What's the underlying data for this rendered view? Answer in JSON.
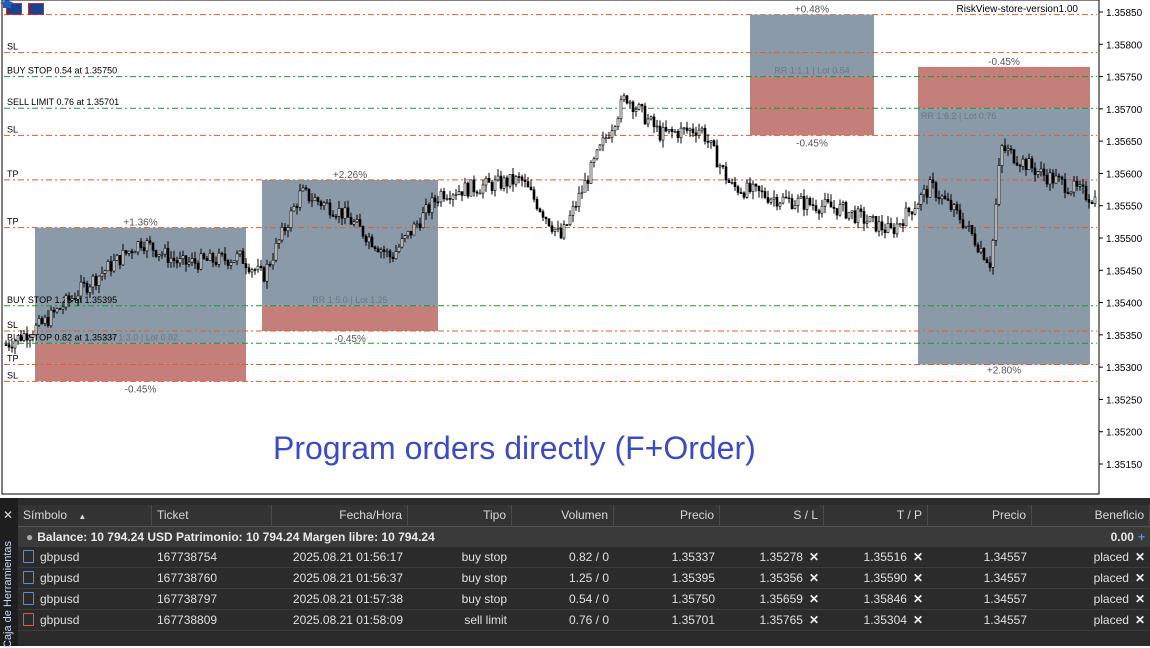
{
  "chart": {
    "indicator_title": "RiskView-store-version1.00",
    "headline": "Program orders directly (F+Order)",
    "price_scale": {
      "ticks": [
        "1.35850",
        "1.35800",
        "1.35750",
        "1.35700",
        "1.35650",
        "1.35600",
        "1.35550",
        "1.35500",
        "1.35450",
        "1.35400",
        "1.35350",
        "1.35300",
        "1.35250",
        "1.35200",
        "1.35150"
      ],
      "min": 1.3513,
      "max": 1.35865
    },
    "level_labels": [
      {
        "text": "SL",
        "price": 1.35787
      },
      {
        "text": "BUY STOP 0.54 at 1.35750",
        "price": 1.3575
      },
      {
        "text": "SELL LIMIT 0.76 at 1.35701",
        "price": 1.35701
      },
      {
        "text": "SL",
        "price": 1.35659
      },
      {
        "text": "TP",
        "price": 1.3559
      },
      {
        "text": "TP",
        "price": 1.35516
      },
      {
        "text": "BUY STOP 1.25 at 1.35395",
        "price": 1.35395
      },
      {
        "text": "SL",
        "price": 1.35356
      },
      {
        "text": "BUY STOP 0.82 at 1.35337",
        "price": 1.35337
      },
      {
        "text": "TP",
        "price": 1.35304
      },
      {
        "text": "SL",
        "price": 1.35278
      }
    ],
    "position_boxes": [
      {
        "tp_pct": "+1.36%",
        "sl_pct": "-0.45%",
        "rr": "RR 1:3.0 | Lot 0.82",
        "entry": 1.35337,
        "sl": 1.35278,
        "tp": 1.35516,
        "color_tp": "#8b9aa8",
        "color_sl": "#c47f7a"
      },
      {
        "tp_pct": "+2.26%",
        "sl_pct": "-0.45%",
        "rr": "RR 1:5.0 | Lot 1.25",
        "entry": 1.35395,
        "sl": 1.35356,
        "tp": 1.3559,
        "color_tp": "#8b9aa8",
        "color_sl": "#c47f7a"
      },
      {
        "tp_pct": "+0.48%",
        "sl_pct": "-0.45%",
        "rr": "RR 1:1.1 | Lot 0.54",
        "entry": 1.3575,
        "sl": 1.35659,
        "tp": 1.35846,
        "color_tp": "#8b9aa8",
        "color_sl": "#c47f7a"
      },
      {
        "tp_pct": "+2.80%",
        "sl_pct": "-0.45%",
        "rr": "RR 1:6.2 | Lot 0.76",
        "entry": 1.35701,
        "sl": 1.35765,
        "tp": 1.35304,
        "color_tp": "#8b9aa8",
        "color_sl": "#c47f7a"
      }
    ]
  },
  "panel": {
    "side_label": "Caja de Herramientas",
    "columns": [
      "Símbolo",
      "Ticket",
      "Fecha/Hora",
      "Tipo",
      "Volumen",
      "Precio",
      "S / L",
      "T / P",
      "Precio",
      "Beneficio"
    ],
    "balance_text": "Balance: 10 794.24 USD  Patrimonio: 10 794.24  Margen libre: 10 794.24",
    "balance_profit": "0.00",
    "rows": [
      {
        "symbol": "gbpusd",
        "ticket": "167738754",
        "time": "2025.08.21 01:56:17",
        "type": "buy stop",
        "volume": "0.82 / 0",
        "price": "1.35337",
        "sl": "1.35278",
        "tp": "1.35516",
        "cur_price": "1.34557",
        "profit": "placed",
        "icon_color": "#4c8fe8"
      },
      {
        "symbol": "gbpusd",
        "ticket": "167738760",
        "time": "2025.08.21 01:56:37",
        "type": "buy stop",
        "volume": "1.25 / 0",
        "price": "1.35395",
        "sl": "1.35356",
        "tp": "1.35590",
        "cur_price": "1.34557",
        "profit": "placed",
        "icon_color": "#4c8fe8"
      },
      {
        "symbol": "gbpusd",
        "ticket": "167738797",
        "time": "2025.08.21 01:57:38",
        "type": "buy stop",
        "volume": "0.54 / 0",
        "price": "1.35750",
        "sl": "1.35659",
        "tp": "1.35846",
        "cur_price": "1.34557",
        "profit": "placed",
        "icon_color": "#4c8fe8"
      },
      {
        "symbol": "gbpusd",
        "ticket": "167738809",
        "time": "2025.08.21 01:58:09",
        "type": "sell limit",
        "volume": "0.76 / 0",
        "price": "1.35701",
        "sl": "1.35765",
        "tp": "1.35304",
        "cur_price": "1.34557",
        "profit": "placed",
        "icon_color": "#e25a4a"
      }
    ]
  }
}
